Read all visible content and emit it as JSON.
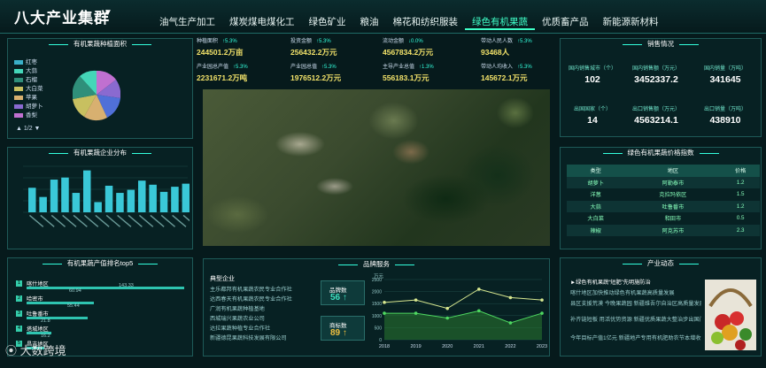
{
  "header": {
    "title": "八大产业集群",
    "tabs": [
      "油气生产加工",
      "煤炭煤电煤化工",
      "绿色矿业",
      "粮油",
      "棉花和纺织服装",
      "绿色有机果蔬",
      "优质畜产品",
      "新能源新材料"
    ],
    "active_tab": 5
  },
  "panels": {
    "area": "有机果蔬种植面积",
    "enterprise": "有机果蔬企业分布",
    "rank": "有机果蔬产值排名top5",
    "sales": "销售情况",
    "price": "绿色有机果蔬价格指数",
    "brand": "品牌服务",
    "news": "产业动态"
  },
  "pie": {
    "legend": [
      {
        "name": "红枣",
        "color": "#3ab0c8"
      },
      {
        "name": "大蒜",
        "color": "#44d6b8"
      },
      {
        "name": "石榴",
        "color": "#2f8f7a"
      },
      {
        "name": "大白菜",
        "color": "#c8c060"
      },
      {
        "name": "苹果",
        "color": "#d8b070"
      },
      {
        "name": "胡萝卜",
        "color": "#8a6ad0"
      },
      {
        "name": "香梨",
        "color": "#c070d0"
      }
    ],
    "pager": "1/2"
  },
  "stats": [
    {
      "label": "种植面积",
      "change": "↑5.3%",
      "value": "244501.2万亩"
    },
    {
      "label": "投资金额",
      "change": "↑5.3%",
      "value": "256432.2万元"
    },
    {
      "label": "流动金额",
      "change": "↓0.0%",
      "value": "4567834.2万元"
    },
    {
      "label": "带动人民人数",
      "change": "↑5.3%",
      "value": "93468人"
    },
    {
      "label": "产业园总产值",
      "change": "↑5.3%",
      "value": "2231671.2万吨"
    },
    {
      "label": "产业园总值",
      "change": "↑5.3%",
      "value": "1976512.2万元"
    },
    {
      "label": "主导产业总值",
      "change": "↑1.3%",
      "value": "556183.1万元"
    },
    {
      "label": "带动人均收入",
      "change": "↑5.3%",
      "value": "145672.1万元"
    }
  ],
  "sales": [
    {
      "label": "国内销售城市（个）",
      "value": "102"
    },
    {
      "label": "国内销售额（万元）",
      "value": "3452337.2"
    },
    {
      "label": "国内销量（万吨）",
      "value": "341645"
    },
    {
      "label": "出国国家（个）",
      "value": "14"
    },
    {
      "label": "出口销售额（万元）",
      "value": "4563214.1"
    },
    {
      "label": "出口销量（万吨）",
      "value": "438910"
    }
  ],
  "price_table": {
    "headers": [
      "类型",
      "地区",
      "价格"
    ],
    "rows": [
      [
        "胡萝卜",
        "阿勒泰市",
        "1.2"
      ],
      [
        "洋葱",
        "克拉玛依区",
        "1.5"
      ],
      [
        "大蒜",
        "吐鲁番市",
        "1.2"
      ],
      [
        "大白菜",
        "和田市",
        "0.5"
      ],
      [
        "辣椒",
        "阿克苏市",
        "2.3"
      ]
    ]
  },
  "rank": [
    {
      "no": "1",
      "name": "喀什地区",
      "value": "143.33"
    },
    {
      "no": "2",
      "name": "哈密市",
      "value": "60.94"
    },
    {
      "no": "3",
      "name": "吐鲁番市",
      "value": "55.44"
    },
    {
      "no": "4",
      "name": "塔城地区",
      "value": "21.8"
    },
    {
      "no": "5",
      "name": "昌吉地区",
      "value": "16.2"
    }
  ],
  "brand": {
    "typical_title": "典型企业",
    "companies": [
      "主乐都邦有机果蔬农民专业合作社",
      "达西春天有机果蔬农民专业合作社",
      "广润有机果蔬种植基地",
      "西城瑞兴果蔬农业公司",
      "达拉果蔬种植专业合作社",
      "新疆德昆果蔬科技发展有限公司"
    ],
    "brand_count_label": "品牌数",
    "brand_count": "56 ↑",
    "trademark_label": "商标数",
    "trademark_count": "89 ↑"
  },
  "news": {
    "items": [
      "►绿色有机果蔬“短肥”先明施防治",
      "喀什地区加快推动绿色有机果蔬高质量发展",
      "县区支援荒漠 今晚果蔬园 新疆维吾尔自治区高质量发展五问",
      "补齐链短板 用活优势资源 新疆优质果蔬大整治步出国门",
      "今年目标产值1亿元 新疆地产专用有机肥助农节本增收"
    ]
  },
  "watermark": "大数跨境",
  "bar_chart": {
    "type": "bar",
    "values": [
      48,
      30,
      64,
      68,
      38,
      82,
      20,
      52,
      38,
      44,
      62,
      54,
      40,
      50,
      56
    ]
  },
  "chart_data": {
    "type": "line",
    "x": [
      "2018",
      "2019",
      "2020",
      "2021",
      "2022",
      "2023"
    ],
    "ylabel": "万元",
    "yticks": [
      "2500",
      "2000",
      "1500",
      "1000",
      "500",
      "0"
    ],
    "ylim": [
      0,
      2500
    ],
    "series": [
      {
        "values": [
          1550,
          1650,
          1300,
          2100,
          1750,
          1650
        ],
        "color": "#d8e890"
      },
      {
        "values": [
          1100,
          1100,
          900,
          1200,
          700,
          1100
        ],
        "color": "#4ed860"
      }
    ]
  }
}
